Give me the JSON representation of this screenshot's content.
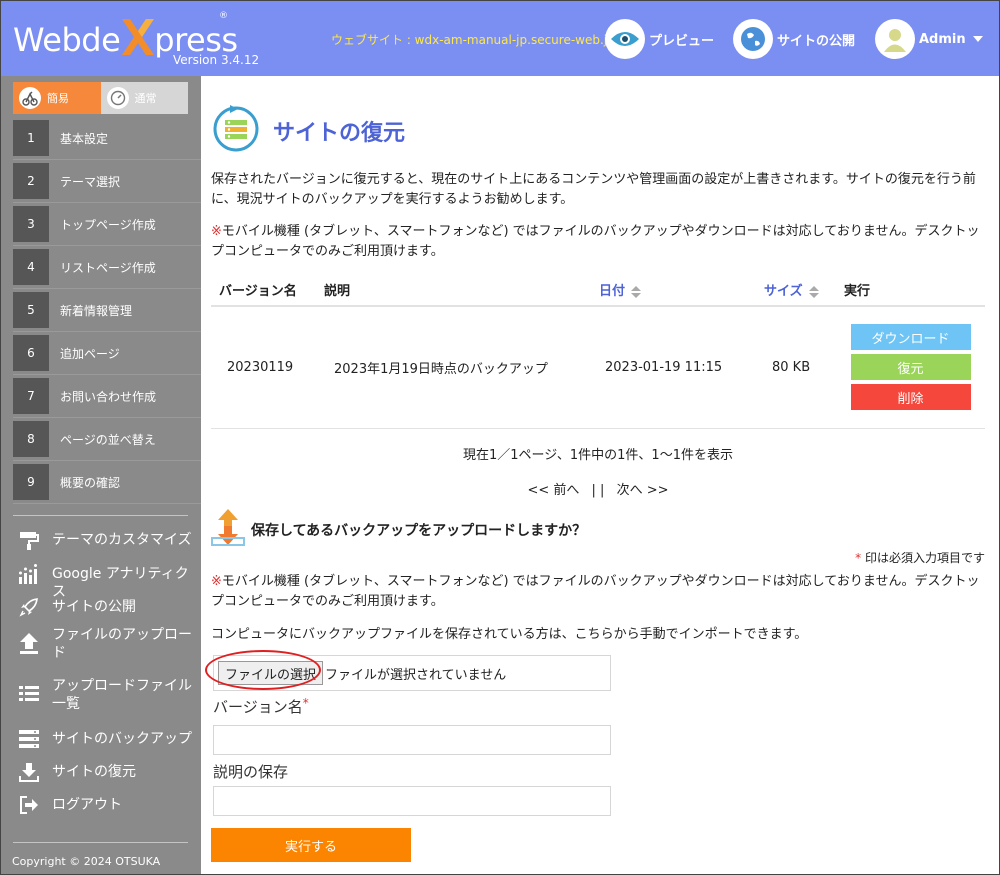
{
  "header": {
    "logo_text_left": "Webde",
    "logo_text_right": "press",
    "logo_reg": "®",
    "version": "Version 3.4.12",
    "site_url": "ウェブサイト : wdx-am-manual-jp.secure-web.jp",
    "preview_label": "プレビュー",
    "publish_label": "サイトの公開",
    "admin_label": "Admin"
  },
  "sidebar": {
    "mode_simple": "簡易",
    "mode_normal": "通常",
    "steps": [
      {
        "num": "1",
        "label": "基本設定"
      },
      {
        "num": "2",
        "label": "テーマ選択"
      },
      {
        "num": "3",
        "label": "トップページ作成"
      },
      {
        "num": "4",
        "label": "リストページ作成"
      },
      {
        "num": "5",
        "label": "新着情報管理"
      },
      {
        "num": "6",
        "label": "追加ページ"
      },
      {
        "num": "7",
        "label": "お問い合わせ作成"
      },
      {
        "num": "8",
        "label": "ページの並べ替え"
      },
      {
        "num": "9",
        "label": "概要の確認"
      }
    ],
    "menu": [
      {
        "label": "テーマのカスタマイズ",
        "icon": "paint-roller-icon"
      },
      {
        "label": "Google アナリティクス",
        "icon": "bar-chart-icon"
      },
      {
        "label": "サイトの公開",
        "icon": "rocket-icon"
      },
      {
        "label": "ファイルのアップロード",
        "icon": "upload-icon"
      },
      {
        "label": "アップロードファイル一覧",
        "icon": "list-icon"
      },
      {
        "label": "サイトのバックアップ",
        "icon": "server-icon"
      },
      {
        "label": "サイトの復元",
        "icon": "download-icon"
      },
      {
        "label": "ログアウト",
        "icon": "logout-icon"
      }
    ],
    "copyright": "Copyright © 2024 OTSUKA"
  },
  "main": {
    "title": "サイトの復元",
    "intro": "保存されたバージョンに復元すると、現在のサイト上にあるコンテンツや管理画面の設定が上書きされます。サイトの復元を行う前に、現況サイトのバックアップを実行するようお勧めします。",
    "mobile_note_mark": "※",
    "mobile_note": "モバイル機種 (タブレット、スマートフォンなど) ではファイルのバックアップやダウンロードは対応しておりません。デスクトップコンピュータでのみご利用頂けます。",
    "table": {
      "headers": {
        "version": "バージョン名",
        "description": "説明",
        "date": "日付",
        "size": "サイズ",
        "action": "実行"
      },
      "rows": [
        {
          "version": "20230119",
          "description": "2023年1月19日時点のバックアップ",
          "date": "2023-01-19 11:15",
          "size": "80 KB",
          "download": "ダウンロード",
          "restore": "復元",
          "delete": "削除"
        }
      ]
    },
    "pager_info": "現在1／1ページ、1件中の1件、1～1件を表示",
    "pager_prev": "<< 前へ",
    "pager_sep": "| |",
    "pager_next": "次へ >>",
    "upload_title": "保存してあるバックアップをアップロードしますか？",
    "required_mark": "*",
    "required_note": " 印は必須入力項目です",
    "import_note": "コンピュータにバックアップファイルを保存されている方は、こちらから手動でインポートできます。",
    "file_button": "ファイルの選択",
    "file_none": "ファイルが選択されていません",
    "version_label": "バージョン名",
    "version_required": "*",
    "version_value": "",
    "desc_label": "説明の保存",
    "desc_value": "",
    "execute_button": "実行する"
  },
  "colors": {
    "header_bg": "#7b8ef2",
    "sidebar_bg": "#8a8a8a",
    "accent_orange": "#fb8500",
    "title_blue": "#4d63d6"
  }
}
